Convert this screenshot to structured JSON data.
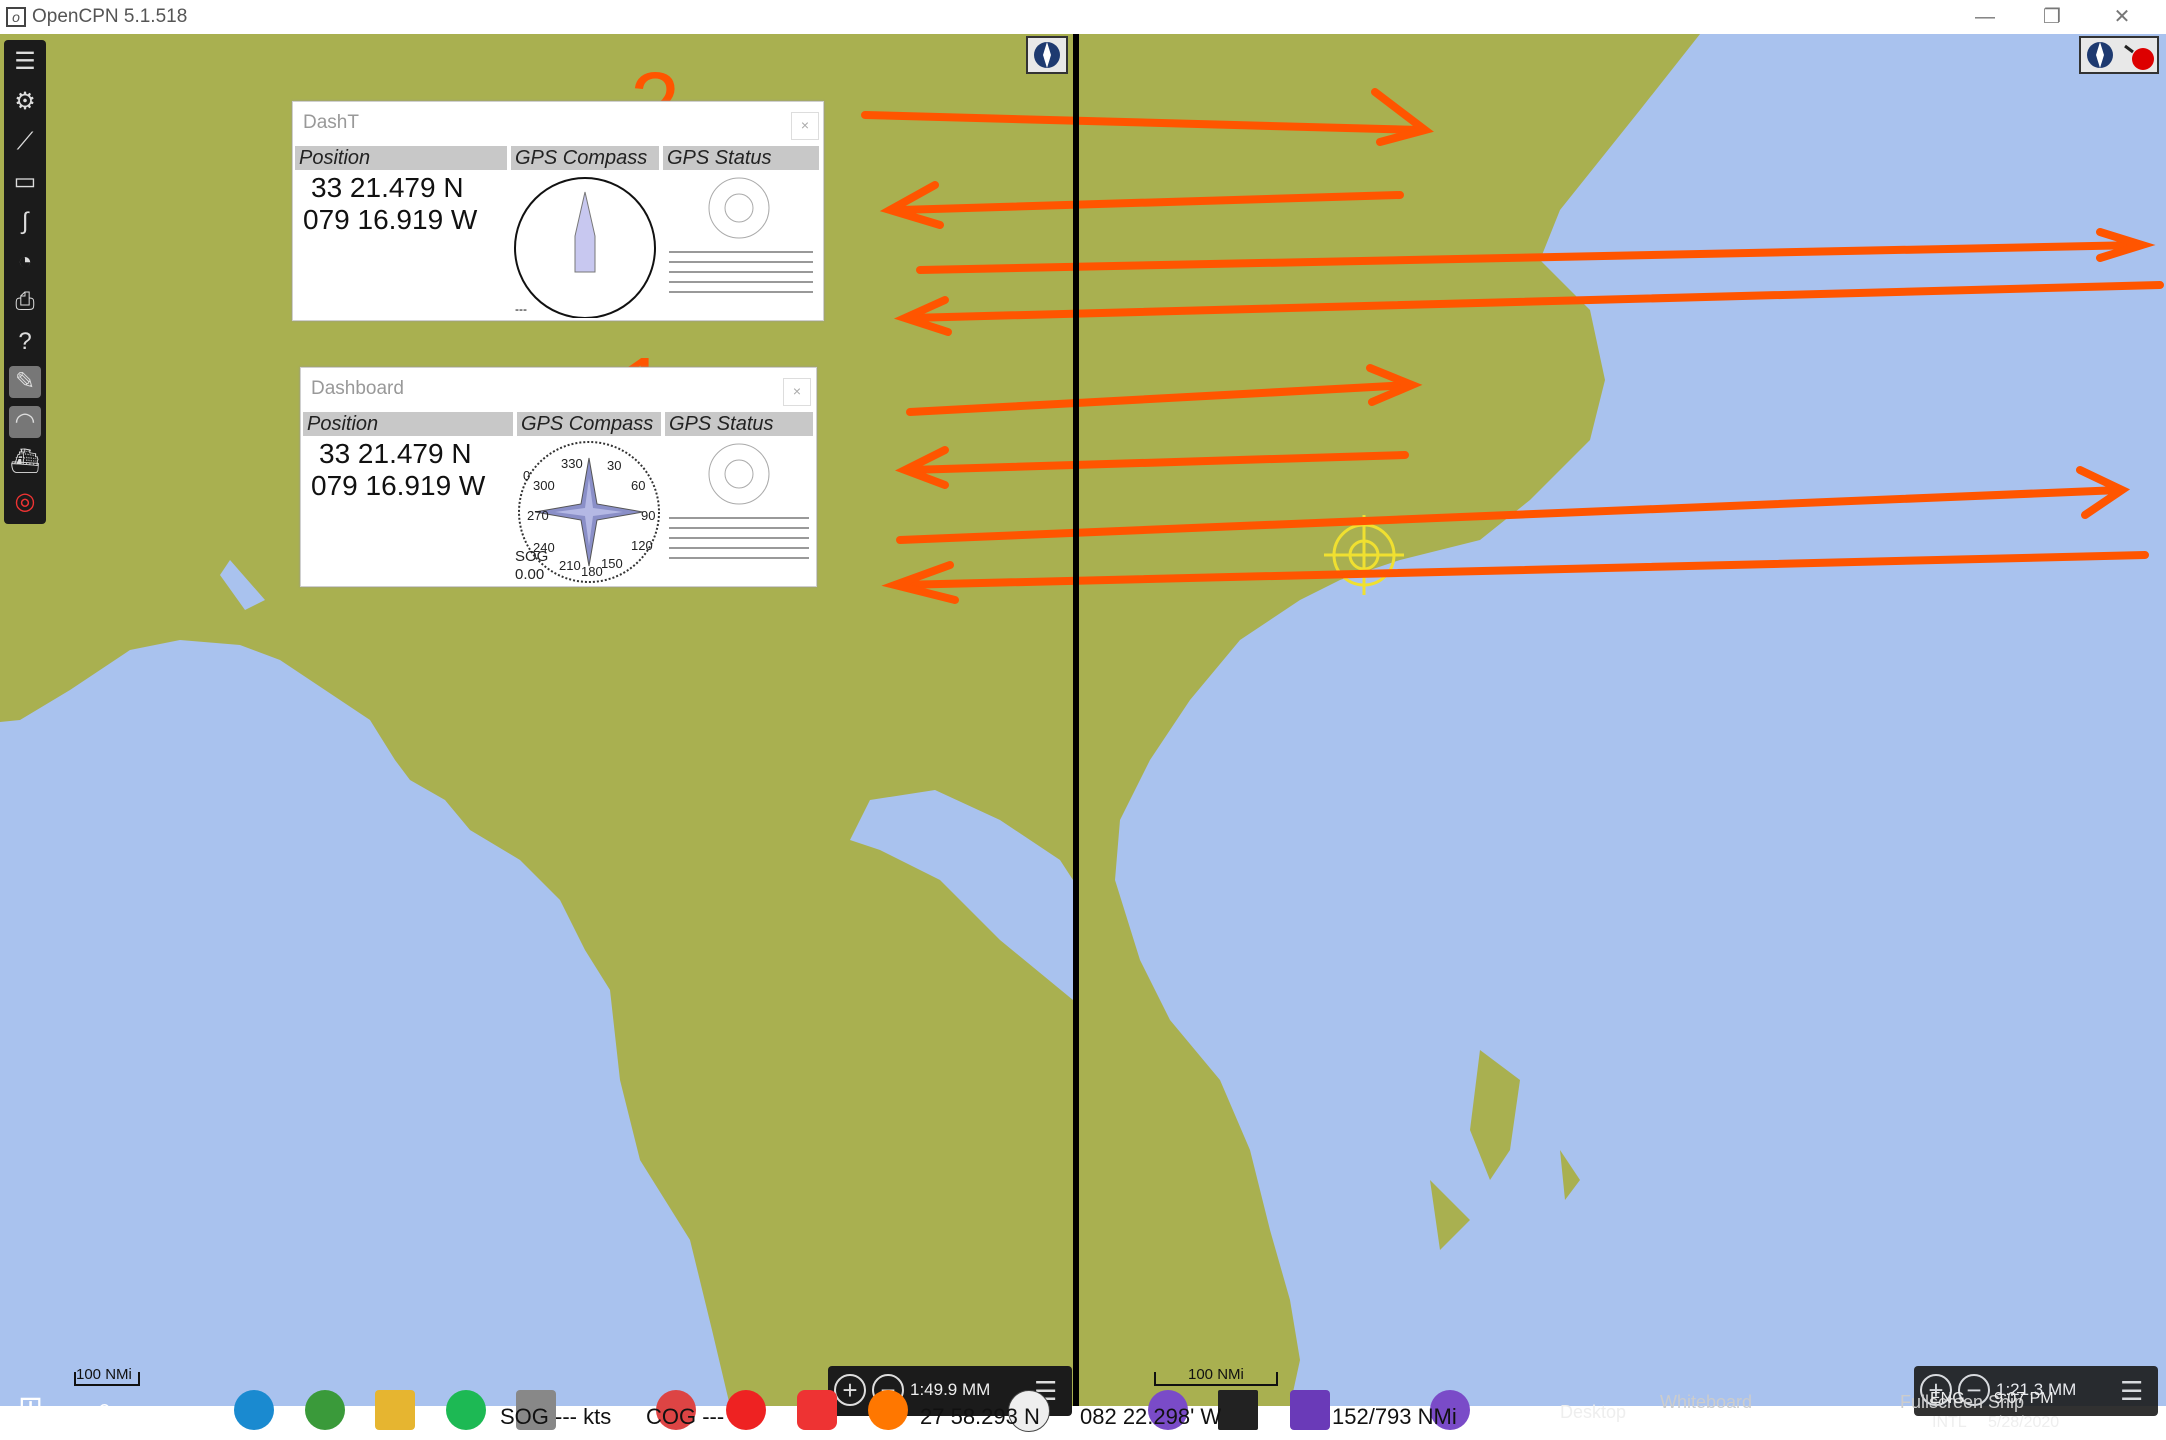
{
  "window": {
    "title": "OpenCPN 5.1.518",
    "minimize": "—",
    "restore": "❐",
    "close": "✕"
  },
  "colors": {
    "land": "#a9b050",
    "water": "#a9c2ee",
    "arrow": "#ff5500",
    "toolbar": "#1b1b1b"
  },
  "annotations": {
    "label_top": "2",
    "label_bottom": "1"
  },
  "dasht": {
    "title": "DashT",
    "close": "×",
    "headers": [
      "Position",
      "GPS Compass",
      "GPS Status"
    ],
    "lat": "33 21.479 N",
    "lon": "079 16.919 W",
    "compass_small": "---"
  },
  "dashboard": {
    "title": "Dashboard",
    "close": "×",
    "headers": [
      "Position",
      "GPS Compass",
      "GPS Status"
    ],
    "lat": "33 21.479 N",
    "lon": "079 16.919 W",
    "sog_label": "SOG",
    "sog_value": "0.00",
    "compass_marks": [
      "0",
      "30",
      "60",
      "90",
      "120",
      "150",
      "180",
      "210",
      "240",
      "270",
      "300",
      "330"
    ]
  },
  "status_left": {
    "scale": "100 NMi",
    "sog": "SOG --- kts",
    "cog": "COG ---",
    "lat": "27 58.293 N",
    "zoom_text": "1:49.9 MM"
  },
  "status_right": {
    "scale": "100 NMi",
    "lon": "082 22.298' W",
    "dist": "152/793 NMi",
    "zoom_text": "1:21.3 MM"
  },
  "taskbar": {
    "desktop": "Desktop",
    "whiteboard": "Whiteboard",
    "fullscreen": "Fullscreen Snip",
    "lang": "ENG",
    "lang2": "INTL",
    "time": "9:07 PM",
    "date": "5/28/2020"
  },
  "toolbar_icons": [
    "menu-icon",
    "settings-icon",
    "route-icon",
    "document-icon",
    "track-icon",
    "tide-icon",
    "print-icon",
    "help-icon",
    "dashboard-plugin-icon",
    "gauge-icon",
    "ship-icon",
    "lifebuoy-icon"
  ]
}
